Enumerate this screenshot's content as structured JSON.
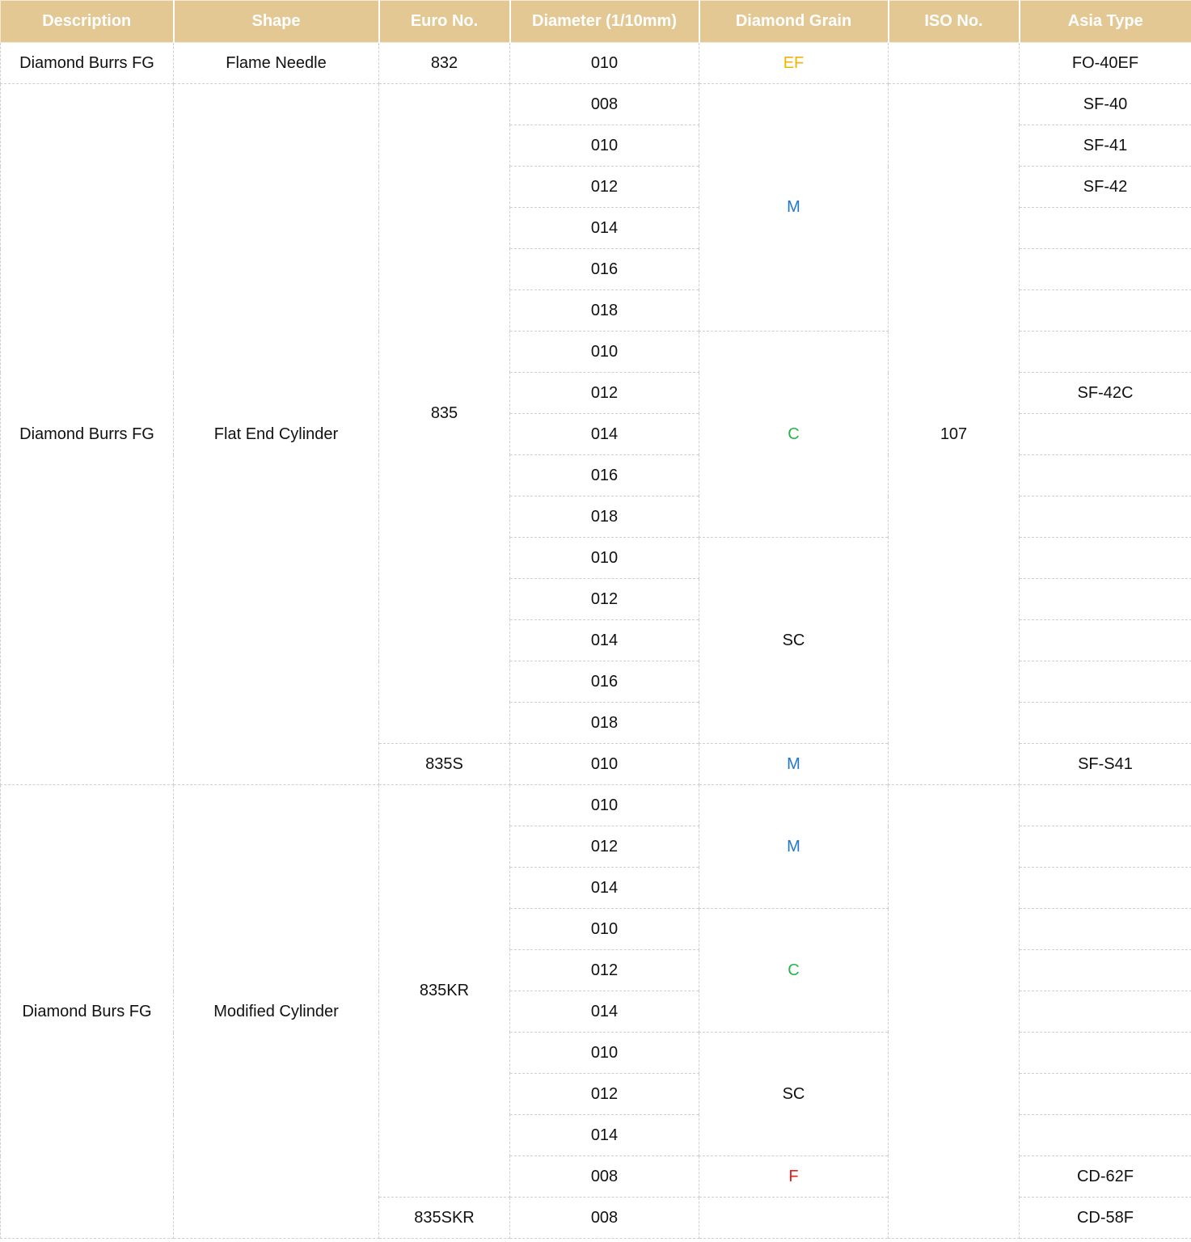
{
  "headers": [
    "Description",
    "Shape",
    "Euro No.",
    "Diameter (1/10mm)",
    "Diamond Grain",
    "ISO No.",
    "Asia Type"
  ],
  "colors": {
    "header_bg": "#e3c894",
    "header_text": "#ffffff",
    "grain_EF": "#f2b400",
    "grain_M": "#1f78c8",
    "grain_C": "#27b54a",
    "grain_SC": "#111111",
    "grain_F": "#ee1c1c"
  },
  "groups": [
    {
      "description": "Diamond Burrs FG",
      "shape": "Flame Needle",
      "euro": "832",
      "diameters": [
        "010"
      ],
      "grain": "EF",
      "iso": "",
      "asia": [
        "FO-40EF"
      ]
    },
    {
      "description": "Diamond Burrs FG",
      "shape": "Flat End Cylinder",
      "euro": "835",
      "euro_alt": "835S",
      "iso": "107",
      "diameters": [
        "008",
        "010",
        "012",
        "014",
        "016",
        "018",
        "010",
        "012",
        "014",
        "016",
        "018",
        "010",
        "012",
        "014",
        "016",
        "018",
        "010"
      ],
      "grains": [
        "M",
        "C",
        "SC",
        "M"
      ],
      "asia": [
        "SF-40",
        "SF-41",
        "SF-42",
        "",
        "",
        "",
        "",
        "SF-42C",
        "",
        "",
        "",
        "",
        "",
        "",
        "",
        "",
        "SF-S41"
      ]
    },
    {
      "description": "Diamond Burs FG",
      "shape": "Modified Cylinder",
      "euro": "835KR",
      "euro_alt": "835SKR",
      "diameters": [
        "010",
        "012",
        "014",
        "010",
        "012",
        "014",
        "010",
        "012",
        "014",
        "008",
        "008"
      ],
      "grains": [
        "M",
        "C",
        "SC",
        "F",
        ""
      ],
      "asia": [
        "",
        "",
        "",
        "",
        "",
        "",
        "",
        "",
        "",
        "CD-62F",
        "CD-58F"
      ]
    }
  ]
}
